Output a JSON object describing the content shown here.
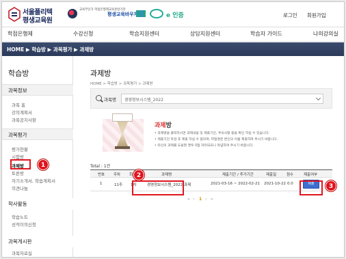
{
  "header": {
    "logo_line1": "서울폴리텍",
    "logo_line2": "평생교육원",
    "partner1_text": "교육부인가 학점은행제교육훈련기관",
    "partner2_text": "평생교육바우처",
    "partner5_text": "e 인증",
    "login": "로그인",
    "signup": "회원가입"
  },
  "gnb": [
    "학점은행제",
    "수강신청",
    "학습지원센터",
    "상담지원센터",
    "학습자 가이드",
    "나의강의실"
  ],
  "breadcrumb_bar": "HOME ▶ 학습방 ▶ 과목평가 ▶ 과제방",
  "sidebar": {
    "title": "학습방",
    "section1": "과목정보",
    "section1_items": [
      "과목 홈",
      "강의계획서",
      "과목공지사항"
    ],
    "section2": "과목평가",
    "section2_items": [
      "평가현황",
      "시험방",
      "과제방",
      "토론방",
      "자기소개서, 학습계획서",
      "의견나눔"
    ],
    "section3": "학사활동",
    "section3_items": [
      "학습노트",
      "성적이의신청"
    ],
    "section4": "과목게시판",
    "section4_items": [
      "과목자료실"
    ]
  },
  "main": {
    "title": "과제방",
    "crumb": "HOME > 학습방 > 과목평가 > 과제방",
    "search_label": "과목명",
    "search_value": "경영정보시스템_2022",
    "intro_title_red": "과제",
    "intro_title_dark": "방",
    "notes": [
      "• 과제명을 클릭하시면 과제내용 및 제출기간, 주의사항 등을 확인 하실 수 있습니다.",
      "• 제출기간 마감 후 제출 하실 수 없으며, 파일명은 본인의 이름 제출하여 주시기 바랍니다.",
      "• 타인의 과제를 도용할 경우 0점 처리되오니 유념하여 주시기 바랍니다."
    ],
    "total_label": "Total : 1건",
    "total_num": "1"
  },
  "table": {
    "headers": [
      "번호",
      "주차",
      "회차",
      "과제명",
      "제출기간 / 추가기간",
      "제출일",
      "점수",
      "제출여부"
    ],
    "rows": [
      {
        "no": "1",
        "week": "11주",
        "session": "1차",
        "name": "경영정보시스템_2022 과제",
        "period": "2021-03-16 ~ 2022-02-21",
        "date": "2021-10-22",
        "score": "0.0",
        "button": "제출"
      }
    ]
  },
  "pager": {
    "prev_first": "«",
    "prev": "‹",
    "current": "1",
    "next": "›",
    "next_last": "»"
  },
  "annotations": [
    "1",
    "2",
    "3"
  ],
  "colors": {
    "accent_red": "#e0141e",
    "nav_bar": "#2c3a5a",
    "submit_blue": "#3d6fd0"
  }
}
